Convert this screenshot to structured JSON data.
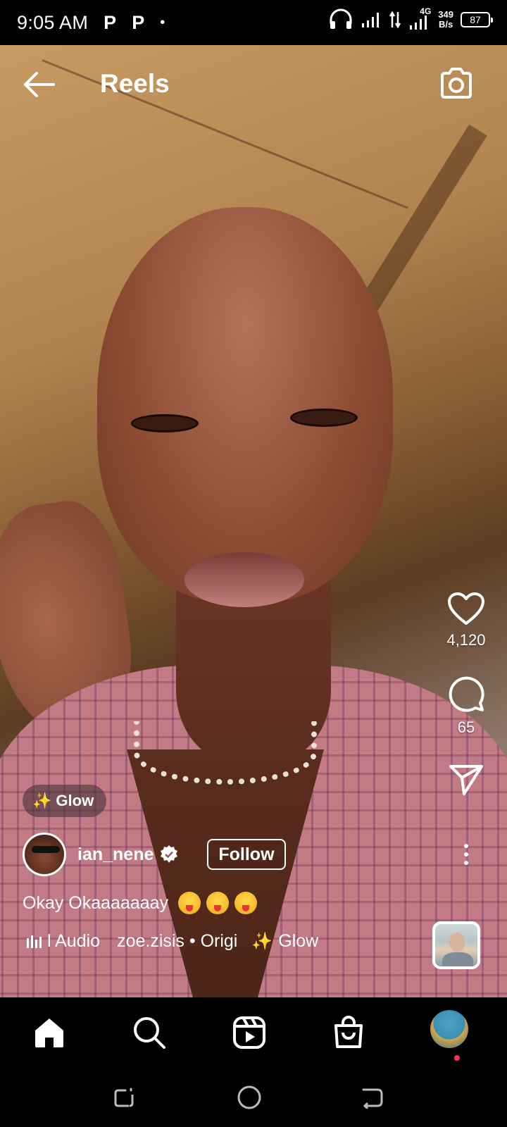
{
  "status_bar": {
    "time": "9:05 AM",
    "notif_1": "P",
    "notif_2": "P",
    "dot": "•",
    "network": "4G",
    "speed_value": "349",
    "speed_unit": "B/s",
    "battery": "87"
  },
  "header": {
    "title": "Reels",
    "back_icon": "arrow-left-icon",
    "camera_icon": "camera-icon"
  },
  "actions": {
    "likes": "4,120",
    "comments": "65"
  },
  "post": {
    "effect_label": "Glow",
    "username": "ian_nene",
    "follow_label": "Follow",
    "caption": "Okay Okaaaaaaay",
    "audio_label": "l Audio",
    "audio_attribution": "zoe.zisis • Origi",
    "effect_label_2": "Glow"
  },
  "nav": {
    "items": [
      "home-icon",
      "search-icon",
      "reels-icon",
      "shop-icon",
      "profile-avatar"
    ]
  },
  "colors": {
    "background": "#000000",
    "notification_dot": "#ff2f55",
    "text": "#ffffff"
  }
}
